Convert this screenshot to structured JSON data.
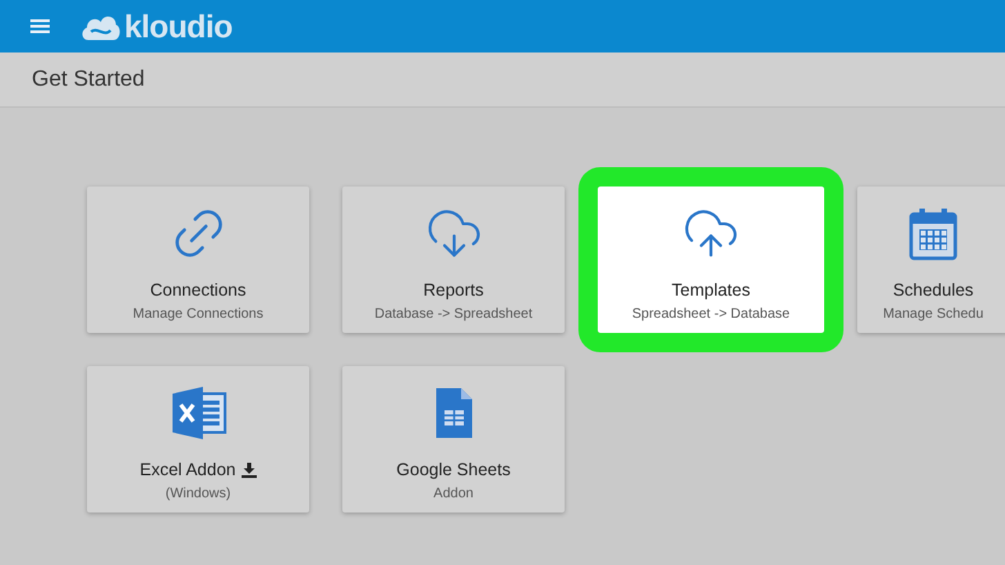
{
  "header": {
    "logo_text": "kloudio"
  },
  "page_title": "Get Started",
  "cards": [
    {
      "title": "Connections",
      "subtitle": "Manage Connections",
      "selected": false
    },
    {
      "title": "Reports",
      "subtitle": "Database -> Spreadsheet",
      "selected": false
    },
    {
      "title": "Templates",
      "subtitle": "Spreadsheet -> Database",
      "selected": true
    },
    {
      "title": "Schedules",
      "subtitle": "Manage Schedu",
      "selected": false
    },
    {
      "title": "Excel Addon",
      "subtitle": "(Windows)",
      "selected": false
    },
    {
      "title": "Google Sheets",
      "subtitle": "Addon",
      "selected": false
    }
  ]
}
